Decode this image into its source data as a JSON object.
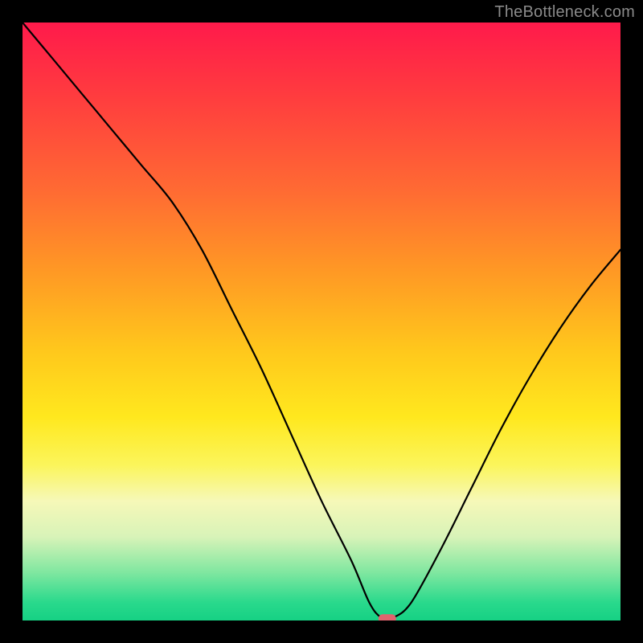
{
  "watermark": "TheBottleneck.com",
  "chart_data": {
    "type": "line",
    "title": "",
    "xlabel": "",
    "ylabel": "",
    "xlim": [
      0,
      100
    ],
    "ylim": [
      0,
      100
    ],
    "grid": false,
    "series": [
      {
        "name": "bottleneck_curve",
        "x": [
          0,
          5,
          10,
          15,
          20,
          25,
          30,
          35,
          40,
          45,
          50,
          55,
          58,
          60,
          62,
          65,
          70,
          75,
          80,
          85,
          90,
          95,
          100
        ],
        "values": [
          100,
          94,
          88,
          82,
          76,
          70,
          62,
          52,
          42,
          31,
          20,
          10,
          3,
          0.5,
          0.5,
          3,
          12,
          22,
          32,
          41,
          49,
          56,
          62
        ]
      }
    ],
    "marker": {
      "x": 61,
      "y": 0.3,
      "color": "#e0646e"
    },
    "background_gradient": {
      "top": "#ff1a4b",
      "mid": "#ffe81e",
      "bottom": "#16d184"
    }
  }
}
